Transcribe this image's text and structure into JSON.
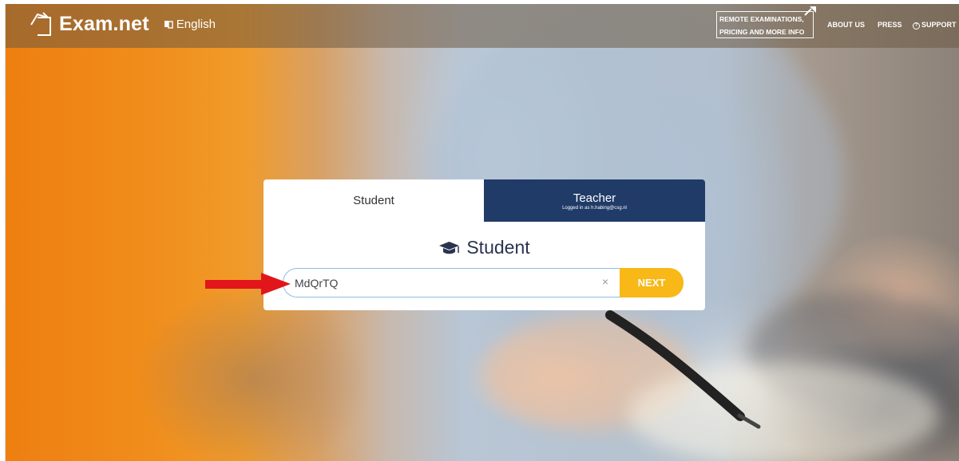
{
  "header": {
    "brand": "Exam.net",
    "language": "English",
    "remote_info_line1": "REMOTE EXAMINATIONS,",
    "remote_info_line2": "PRICING AND MORE INFO",
    "about": "ABOUT US",
    "press": "PRESS",
    "support": "SUPPORT"
  },
  "login": {
    "tabs": [
      {
        "label": "Student"
      },
      {
        "label": "Teacher",
        "subtext": "Logged in as h.habing@csg.nl"
      }
    ],
    "heading": "Student",
    "code_value": "MdQrTQ",
    "next": "NEXT",
    "clear": "×"
  },
  "colors": {
    "orange": "#f08c1a",
    "teacher_tab": "#203b67",
    "next_button": "#f7b818",
    "arrow": "#e2151b"
  },
  "icons": {
    "logo": "exam-net-logo-icon",
    "language": "language-icon",
    "remote": "external-arrow-icon",
    "support": "question-circle-icon",
    "student": "graduation-cap-icon",
    "clear": "close-icon"
  }
}
